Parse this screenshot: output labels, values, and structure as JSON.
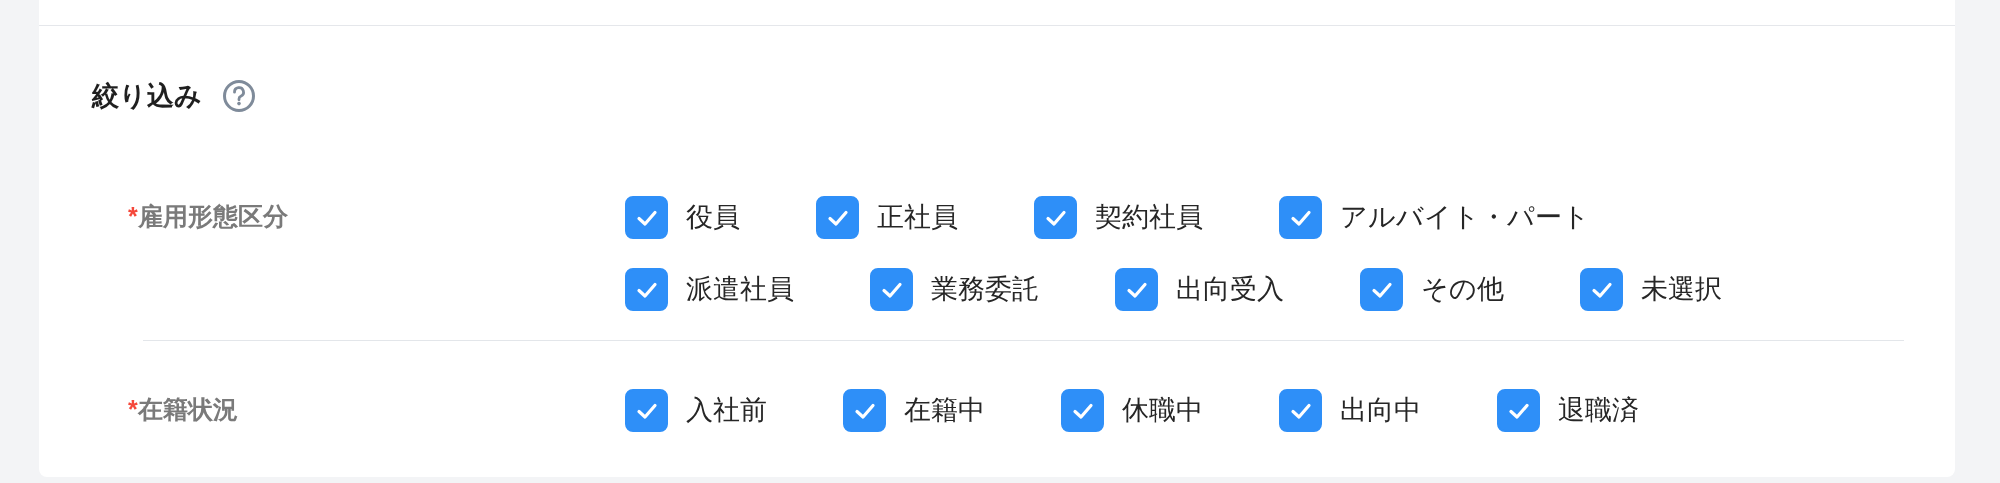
{
  "filter": {
    "title": "絞り込み",
    "groups": [
      {
        "label": "雇用形態区分",
        "required": "*",
        "rows": [
          [
            {
              "label": "役員",
              "checked": true
            },
            {
              "label": "正社員",
              "checked": true
            },
            {
              "label": "契約社員",
              "checked": true
            },
            {
              "label": "アルバイト・パート",
              "checked": true
            }
          ],
          [
            {
              "label": "派遣社員",
              "checked": true
            },
            {
              "label": "業務委託",
              "checked": true
            },
            {
              "label": "出向受入",
              "checked": true
            },
            {
              "label": "その他",
              "checked": true
            },
            {
              "label": "未選択",
              "checked": true
            }
          ]
        ]
      },
      {
        "label": "在籍状況",
        "required": "*",
        "rows": [
          [
            {
              "label": "入社前",
              "checked": true
            },
            {
              "label": "在籍中",
              "checked": true
            },
            {
              "label": "休職中",
              "checked": true
            },
            {
              "label": "出向中",
              "checked": true
            },
            {
              "label": "退職済",
              "checked": true
            }
          ]
        ]
      }
    ]
  }
}
